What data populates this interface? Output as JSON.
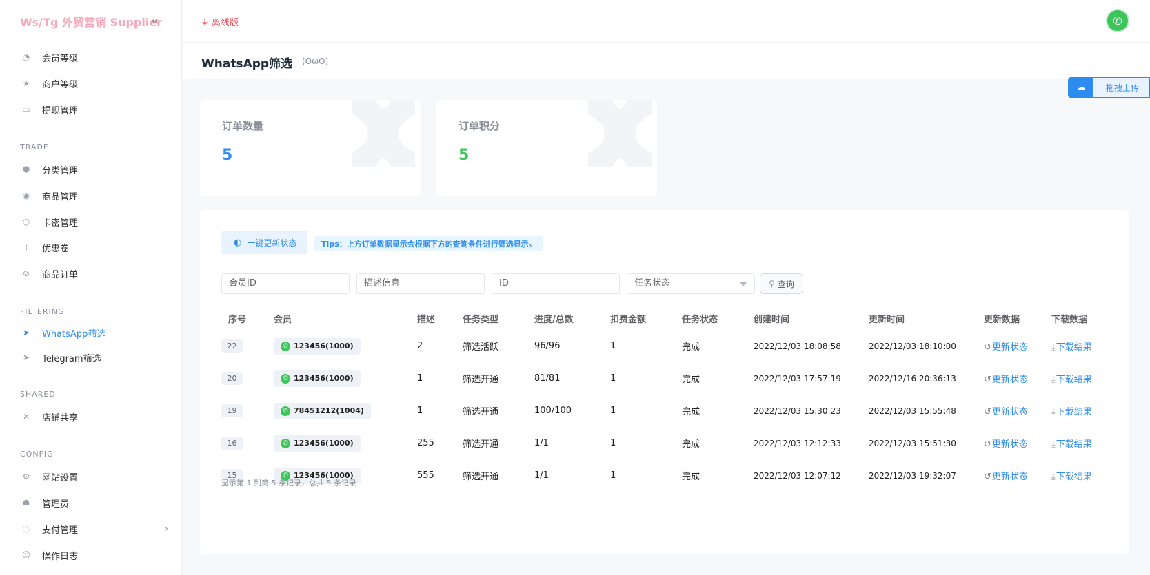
{
  "brand": {
    "title": "Ws/Tg 外贸营销 Supplier",
    "collapse_icon": "double-chevron-left-icon"
  },
  "sidebar": {
    "top_items": [
      {
        "label": "会员等级",
        "icon": "member-level-icon"
      },
      {
        "label": "商户等级",
        "icon": "merchant-level-icon"
      },
      {
        "label": "提现管理",
        "icon": "withdraw-icon"
      }
    ],
    "sections": [
      {
        "title": "TRADE",
        "items": [
          {
            "label": "分类管理",
            "icon": "category-icon"
          },
          {
            "label": "商品管理",
            "icon": "product-icon"
          },
          {
            "label": "卡密管理",
            "icon": "card-key-icon"
          },
          {
            "label": "优惠卷",
            "icon": "coupon-icon"
          },
          {
            "label": "商品订单",
            "icon": "order-icon"
          }
        ]
      },
      {
        "title": "FILTERING",
        "items": [
          {
            "label": "WhatsApp筛选",
            "icon": "telegram-send-icon",
            "active": true
          },
          {
            "label": "Telegram筛选",
            "icon": "telegram-send-icon"
          }
        ]
      },
      {
        "title": "SHARED",
        "items": [
          {
            "label": "店铺共享",
            "icon": "share-icon"
          }
        ]
      },
      {
        "title": "CONFIG",
        "items": [
          {
            "label": "网站设置",
            "icon": "gear-icon"
          },
          {
            "label": "管理员",
            "icon": "admin-icon"
          },
          {
            "label": "支付管理",
            "icon": "payment-icon",
            "has_submenu": true
          },
          {
            "label": "操作日志",
            "icon": "log-icon"
          }
        ]
      }
    ]
  },
  "topbar": {
    "offline_label": "离线版",
    "avatar_icon": "whatsapp-avatar-icon"
  },
  "page": {
    "title": "WhatsApp筛选",
    "emoticon": "(ʘωʘ)"
  },
  "upload": {
    "label": "拖拽上传"
  },
  "stats": [
    {
      "label": "订单数量",
      "value": "5",
      "color": "#2d8cf0"
    },
    {
      "label": "订单积分",
      "value": "5",
      "color": "#3cc65a"
    }
  ],
  "toolbar": {
    "refresh_all_label": "一键更新状态",
    "tips": "Tips：上方订单数据显示会根据下方的查询条件进行筛选显示。"
  },
  "filters": {
    "member_id_placeholder": "会员ID",
    "description_placeholder": "描述信息",
    "id_placeholder": "ID",
    "status_placeholder": "任务状态",
    "query_label": "查询"
  },
  "table": {
    "headers": [
      "序号",
      "会员",
      "描述",
      "任务类型",
      "进度/总数",
      "扣费金额",
      "任务状态",
      "创建时间",
      "更新时间",
      "更新数据",
      "下载数据"
    ],
    "update_action": "更新状态",
    "download_action": "下载结果",
    "rows": [
      {
        "seq": "22",
        "member": "123456(1000)",
        "desc": "2",
        "type": "筛选活跃",
        "progress": "96/96",
        "fee": "1",
        "status": "完成",
        "created": "2022/12/03 18:08:58",
        "updated": "2022/12/03 18:10:00"
      },
      {
        "seq": "20",
        "member": "123456(1000)",
        "desc": "1",
        "type": "筛选开通",
        "progress": "81/81",
        "fee": "1",
        "status": "完成",
        "created": "2022/12/03 17:57:19",
        "updated": "2022/12/16 20:36:13"
      },
      {
        "seq": "19",
        "member": "78451212(1004)",
        "desc": "1",
        "type": "筛选开通",
        "progress": "100/100",
        "fee": "1",
        "status": "完成",
        "created": "2022/12/03 15:30:23",
        "updated": "2022/12/03 15:55:48"
      },
      {
        "seq": "16",
        "member": "123456(1000)",
        "desc": "255",
        "type": "筛选开通",
        "progress": "1/1",
        "fee": "1",
        "status": "完成",
        "created": "2022/12/03 12:12:33",
        "updated": "2022/12/03 15:51:30"
      },
      {
        "seq": "15",
        "member": "123456(1000)",
        "desc": "555",
        "type": "筛选开通",
        "progress": "1/1",
        "fee": "1",
        "status": "完成",
        "created": "2022/12/03 12:07:12",
        "updated": "2022/12/03 19:32:07"
      }
    ]
  },
  "pagination": {
    "info": "显示第 1 到第 5 条记录，总共 5 条记录"
  }
}
